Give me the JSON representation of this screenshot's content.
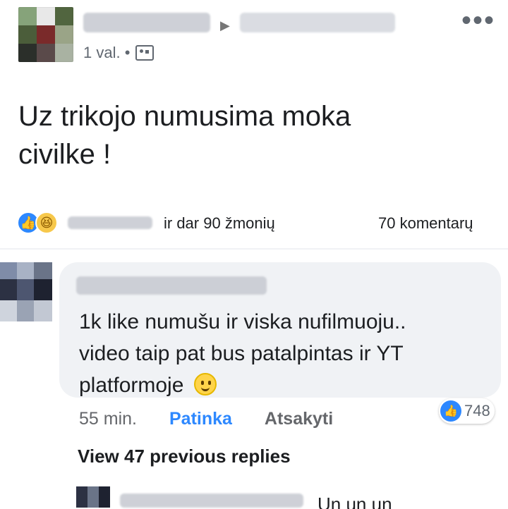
{
  "post": {
    "time_label": "1 val. •",
    "menu_label": "•••",
    "text_line1": "Uz trikojo numusima moka",
    "text_line2": "civilke !",
    "reactions_text": "ir dar 90 žmonių",
    "comments_text": "70 komentarų"
  },
  "comment": {
    "text_line1": "1k like numušu ir viska nufilmuoju..",
    "text_line2": "video taip pat bus patalpintas ir YT",
    "text_line3": "platformoje",
    "time": "55 min.",
    "like_action": "Patinka",
    "reply_action": "Atsakyti",
    "like_count": "748"
  },
  "replies": {
    "view_more": "View 47 previous replies",
    "next_preview": "Un un un"
  },
  "icons": {
    "top_avatar": "avatar-image",
    "comment_avatar": "avatar-image",
    "reaction_like": "like-icon",
    "reaction_haha": "haha-icon",
    "privacy": "friends-icon",
    "menu": "more-icon"
  },
  "colors": {
    "facebook_blue": "#2d88ff",
    "bubble_gray": "#f0f2f5",
    "text_primary": "#1c1e21",
    "text_secondary": "#606770"
  }
}
